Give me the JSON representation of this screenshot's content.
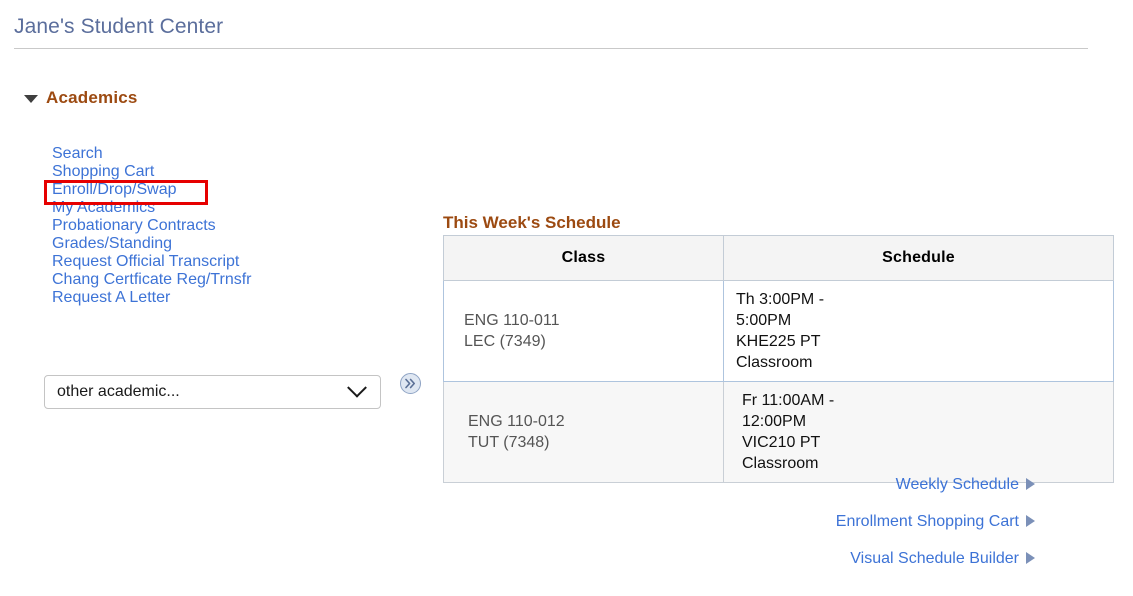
{
  "page": {
    "title": "Jane's Student Center"
  },
  "academics": {
    "section_label": "Academics",
    "collapse_icon": "triangle-down-icon",
    "links": [
      {
        "label": "Search"
      },
      {
        "label": "Shopping Cart"
      },
      {
        "label": "Enroll/Drop/Swap"
      },
      {
        "label": "My Academics"
      },
      {
        "label": "Probationary Contracts"
      },
      {
        "label": "Grades/Standing"
      },
      {
        "label": "Request Official Transcript"
      },
      {
        "label": "Chang Certficate Reg/Trnsfr"
      },
      {
        "label": "Request A Letter"
      }
    ],
    "highlight": {
      "target_label": "Enroll/Drop/Swap",
      "color": "#e60000"
    },
    "other_select": {
      "value": "other academic...",
      "chevron_icon": "chevron-down-icon"
    },
    "go_button": {
      "icon": "double-chevron-right-icon",
      "fill": "#dfe7f2",
      "stroke": "#8ea3c4"
    }
  },
  "schedule": {
    "heading": "This Week's Schedule",
    "columns": [
      "Class",
      "Schedule"
    ],
    "rows": [
      {
        "class_line1": "ENG 110-011",
        "class_line2": "LEC (7349)",
        "sched_line1": "Th 3:00PM -",
        "sched_line2": "5:00PM",
        "sched_line3": "KHE225 PT",
        "sched_line4": "Classroom"
      },
      {
        "class_line1": "ENG 110-012",
        "class_line2": "TUT (7348)",
        "sched_line1": "Fr 11:00AM -",
        "sched_line2": "12:00PM",
        "sched_line3": "VIC210 PT",
        "sched_line4": "Classroom"
      }
    ],
    "actions": [
      {
        "label": "Weekly Schedule",
        "icon": "triangle-right-icon"
      },
      {
        "label": "Enrollment Shopping Cart",
        "icon": "triangle-right-icon"
      },
      {
        "label": "Visual Schedule Builder",
        "icon": "triangle-right-icon"
      }
    ]
  },
  "colors": {
    "title_blue": "#5b6e9c",
    "link_blue": "#3d73d6",
    "heading_brown": "#9c4a11",
    "table_border": "#c3ccd6",
    "annotation_red": "#e60000"
  }
}
